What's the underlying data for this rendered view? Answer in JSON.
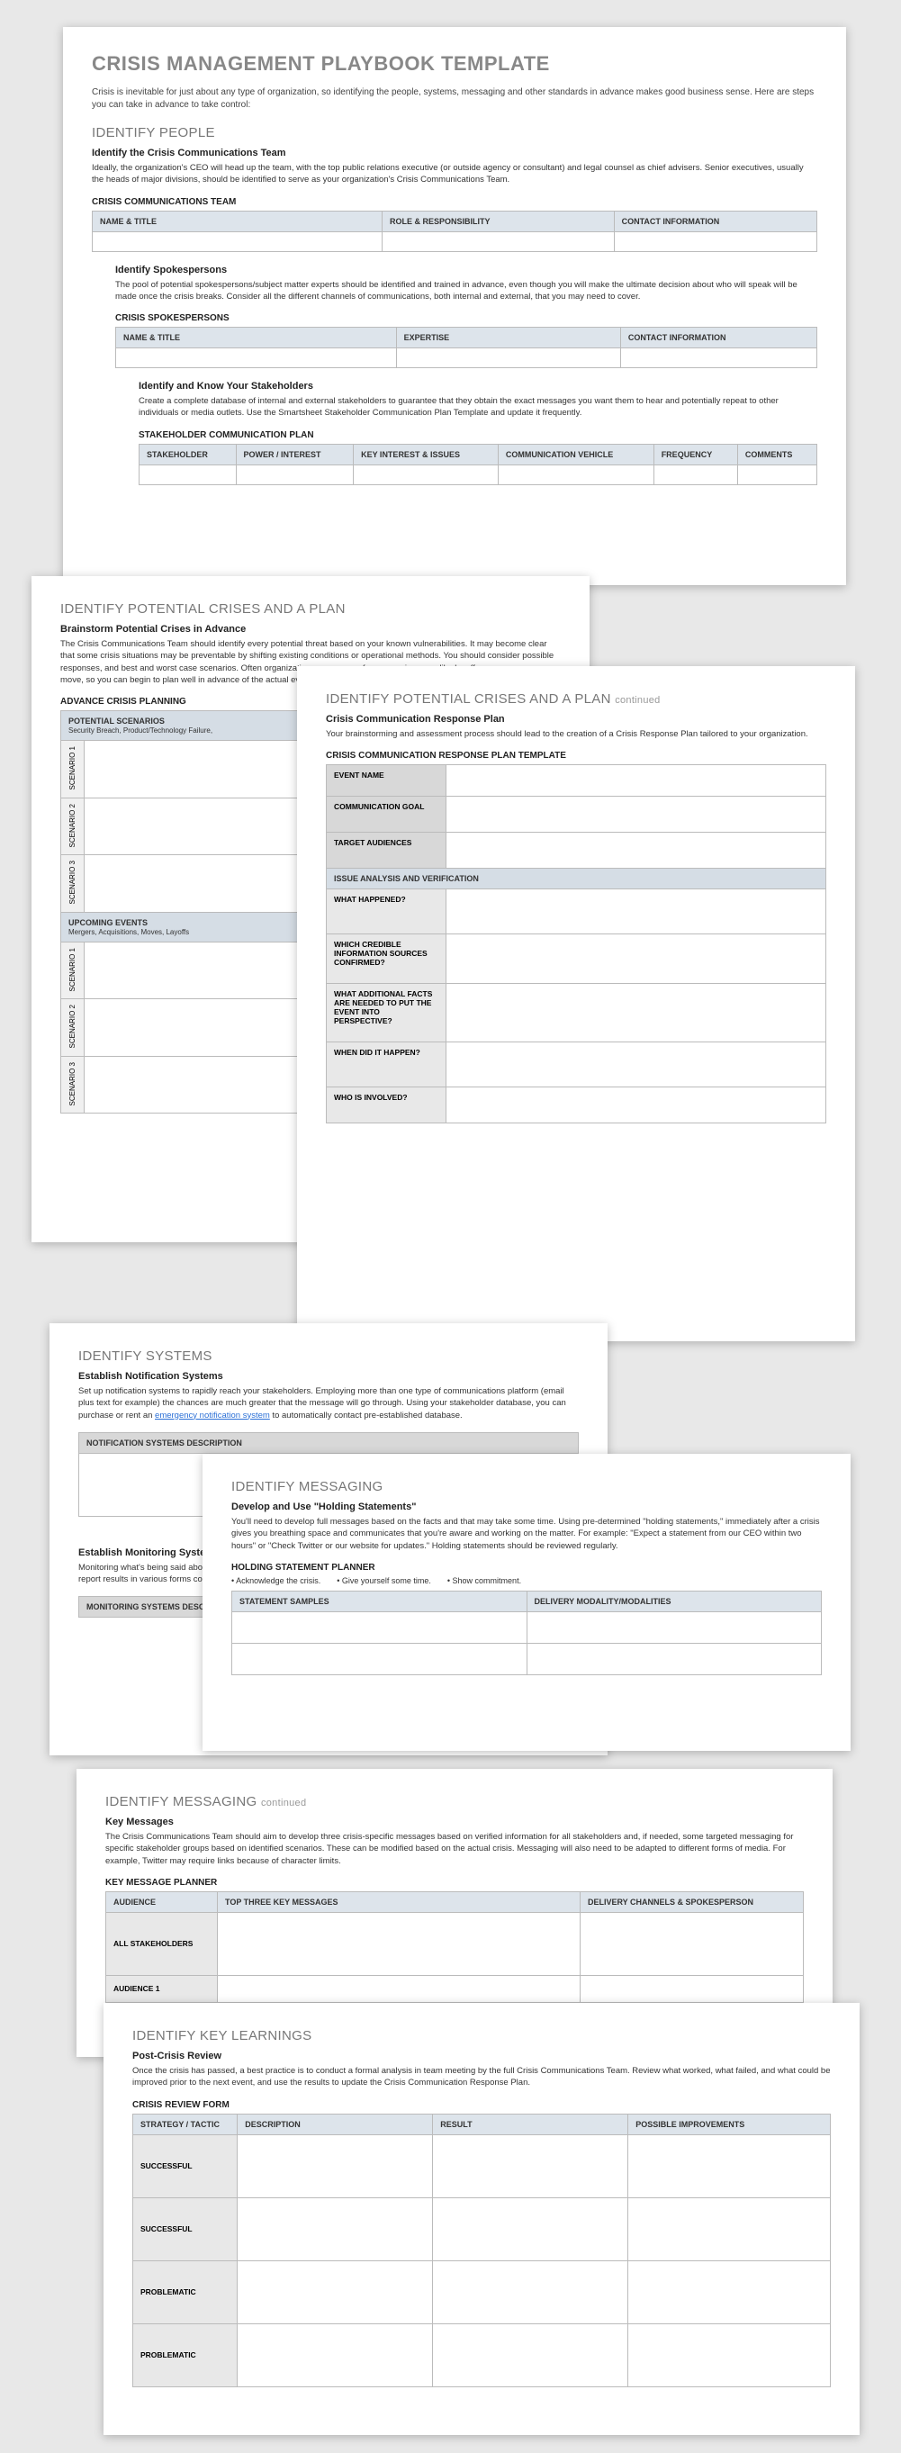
{
  "page1": {
    "title": "CRISIS MANAGEMENT PLAYBOOK TEMPLATE",
    "intro": "Crisis is inevitable for just about any type of organization, so identifying the people, systems, messaging and other standards in advance makes good business sense. Here are steps you can take in advance to take control:",
    "sec1": "IDENTIFY PEOPLE",
    "sub1": "Identify the Crisis Communications Team",
    "p1": "Ideally, the organization's CEO will head up the team, with the top public relations executive (or outside agency or consultant) and legal counsel as chief advisers. Senior executives, usually the heads of major divisions, should be identified to serve as your organization's Crisis Communications Team.",
    "tbl1_title": "CRISIS COMMUNICATIONS TEAM",
    "tbl1_h1": "NAME & TITLE",
    "tbl1_h2": "ROLE & RESPONSIBILITY",
    "tbl1_h3": "CONTACT INFORMATION",
    "sub2": "Identify Spokespersons",
    "p2": "The pool of potential spokespersons/subject matter experts should be identified and trained in advance, even though you will make the ultimate decision about who will speak will be made once the crisis breaks. Consider all the different channels of communications, both internal and external, that you may need to cover.",
    "tbl2_title": "CRISIS SPOKESPERSONS",
    "tbl2_h1": "NAME & TITLE",
    "tbl2_h2": "EXPERTISE",
    "tbl2_h3": "CONTACT INFORMATION",
    "sub3": "Identify and Know Your Stakeholders",
    "p3": "Create a complete database of internal and external stakeholders to guarantee that they obtain the exact messages you want them to hear and potentially repeat to other individuals or media outlets. Use the Smartsheet Stakeholder Communication Plan Template and update it frequently.",
    "tbl3_title": "STAKEHOLDER COMMUNICATION PLAN",
    "tbl3_h1": "STAKEHOLDER",
    "tbl3_h2": "POWER / INTEREST",
    "tbl3_h3": "KEY INTEREST & ISSUES",
    "tbl3_h4": "COMMUNICATION VEHICLE",
    "tbl3_h5": "FREQUENCY",
    "tbl3_h6": "COMMENTS"
  },
  "page2": {
    "sec": "IDENTIFY POTENTIAL CRISES AND A PLAN",
    "sub1": "Brainstorm Potential Crises in Advance",
    "p1": "The Crisis Communications Team should identify every potential threat based on your known vulnerabilities. It may become clear that some crisis situations may be preventable by shifting existing conditions or operational methods. You should consider possible responses, and best and worst case scenarios. Often organizations are aware of an upcoming even like layoffs, a merger or a move, so you can begin to plan well in advance of the actual event.",
    "tbl_title": "ADVANCE CRISIS PLANNING",
    "r1": "POTENTIAL SCENARIOS",
    "r1_sub": "Security Breach, Product/Technology Failure,",
    "s1": "SCENARIO 1",
    "s2": "SCENARIO 2",
    "s3": "SCENARIO 3",
    "r2": "UPCOMING EVENTS",
    "r2_sub": "Mergers, Acquisitions, Moves, Layoffs"
  },
  "page3": {
    "sec": "IDENTIFY POTENTIAL CRISES AND A PLAN",
    "cont": "continued",
    "sub1": "Crisis Communication Response Plan",
    "p1": "Your brainstorming and assessment process should lead to the creation of a Crisis Response Plan tailored to your organization.",
    "tbl_title": "CRISIS COMMUNICATION RESPONSE PLAN TEMPLATE",
    "f1": "EVENT NAME",
    "f2": "COMMUNICATION GOAL",
    "f3": "TARGET AUDIENCES",
    "f4": "ISSUE ANALYSIS AND VERIFICATION",
    "f5": "WHAT HAPPENED?",
    "f6": "WHICH CREDIBLE INFORMATION SOURCES CONFIRMED?",
    "f7": "WHAT ADDITIONAL FACTS ARE NEEDED TO PUT THE EVENT INTO PERSPECTIVE?",
    "f8": "WHEN DID IT HAPPEN?",
    "f9": "WHO IS INVOLVED?"
  },
  "page4": {
    "sec": "IDENTIFY SYSTEMS",
    "sub1": "Establish Notification Systems",
    "p1a": "Set up notification systems to rapidly reach your stakeholders. Employing more than one type of communications platform (email plus text for example) the chances are much greater that the message will go through. Using your stakeholder database, you can purchase or rent an ",
    "link": "emergency notification system",
    "p1b": " to automatically contact pre-established database.",
    "tbl1_title": "NOTIFICATION SYSTEMS DESCRIPTION",
    "sub2": "Establish Monitoring Systems",
    "p2": "Monitoring what's being said about you that could foment a crisis. Monitoring strategy and tactics. Free services include services to report results in various forms contact with stakeholders to immediately",
    "tbl2_title": "MONITORING SYSTEMS DESCRIPTION"
  },
  "page5": {
    "sec": "IDENTIFY MESSAGING",
    "sub1": "Develop and Use \"Holding Statements\"",
    "p1": "You'll need to develop full messages based on the facts and that may take some time. Using pre-determined \"holding statements,\" immediately after a crisis gives you breathing space and communicates that you're aware and working on the matter. For example: \"Expect a statement from our CEO within two hours\" or \"Check Twitter or our website for updates.\" Holding statements should be reviewed regularly.",
    "tbl_title": "HOLDING STATEMENT PLANNER",
    "b1": "• Acknowledge the crisis.",
    "b2": "• Give yourself some time.",
    "b3": "• Show commitment.",
    "h1": "STATEMENT SAMPLES",
    "h2": "DELIVERY MODALITY/MODALITIES"
  },
  "page6": {
    "sec": "IDENTIFY MESSAGING",
    "cont": "continued",
    "sub1": "Key Messages",
    "p1": "The Crisis Communications Team should aim to develop three crisis-specific messages based on verified information for all stakeholders and, if needed, some targeted messaging for specific stakeholder groups based on identified scenarios. These can be modified based on the actual crisis. Messaging will also need to be adapted to different forms of media. For example, Twitter may require links because of character limits.",
    "tbl_title": "KEY MESSAGE PLANNER",
    "h1": "AUDIENCE",
    "h2": "TOP THREE KEY MESSAGES",
    "h3": "DELIVERY CHANNELS & SPOKESPERSON",
    "r1": "ALL STAKEHOLDERS",
    "r2": "AUDIENCE 1"
  },
  "page7": {
    "sec": "IDENTIFY KEY LEARNINGS",
    "sub1": "Post-Crisis Review",
    "p1": "Once the crisis has passed, a best practice is to conduct a formal analysis in team meeting by the full Crisis Communications Team. Review what worked, what failed, and what could be improved prior to the next event, and use the results to update the Crisis Communication Response Plan.",
    "tbl_title": "CRISIS REVIEW FORM",
    "h1": "STRATEGY / TACTIC",
    "h2": "DESCRIPTION",
    "h3": "RESULT",
    "h4": "POSSIBLE IMPROVEMENTS",
    "r1": "SUCCESSFUL",
    "r2": "SUCCESSFUL",
    "r3": "PROBLEMATIC",
    "r4": "PROBLEMATIC"
  }
}
